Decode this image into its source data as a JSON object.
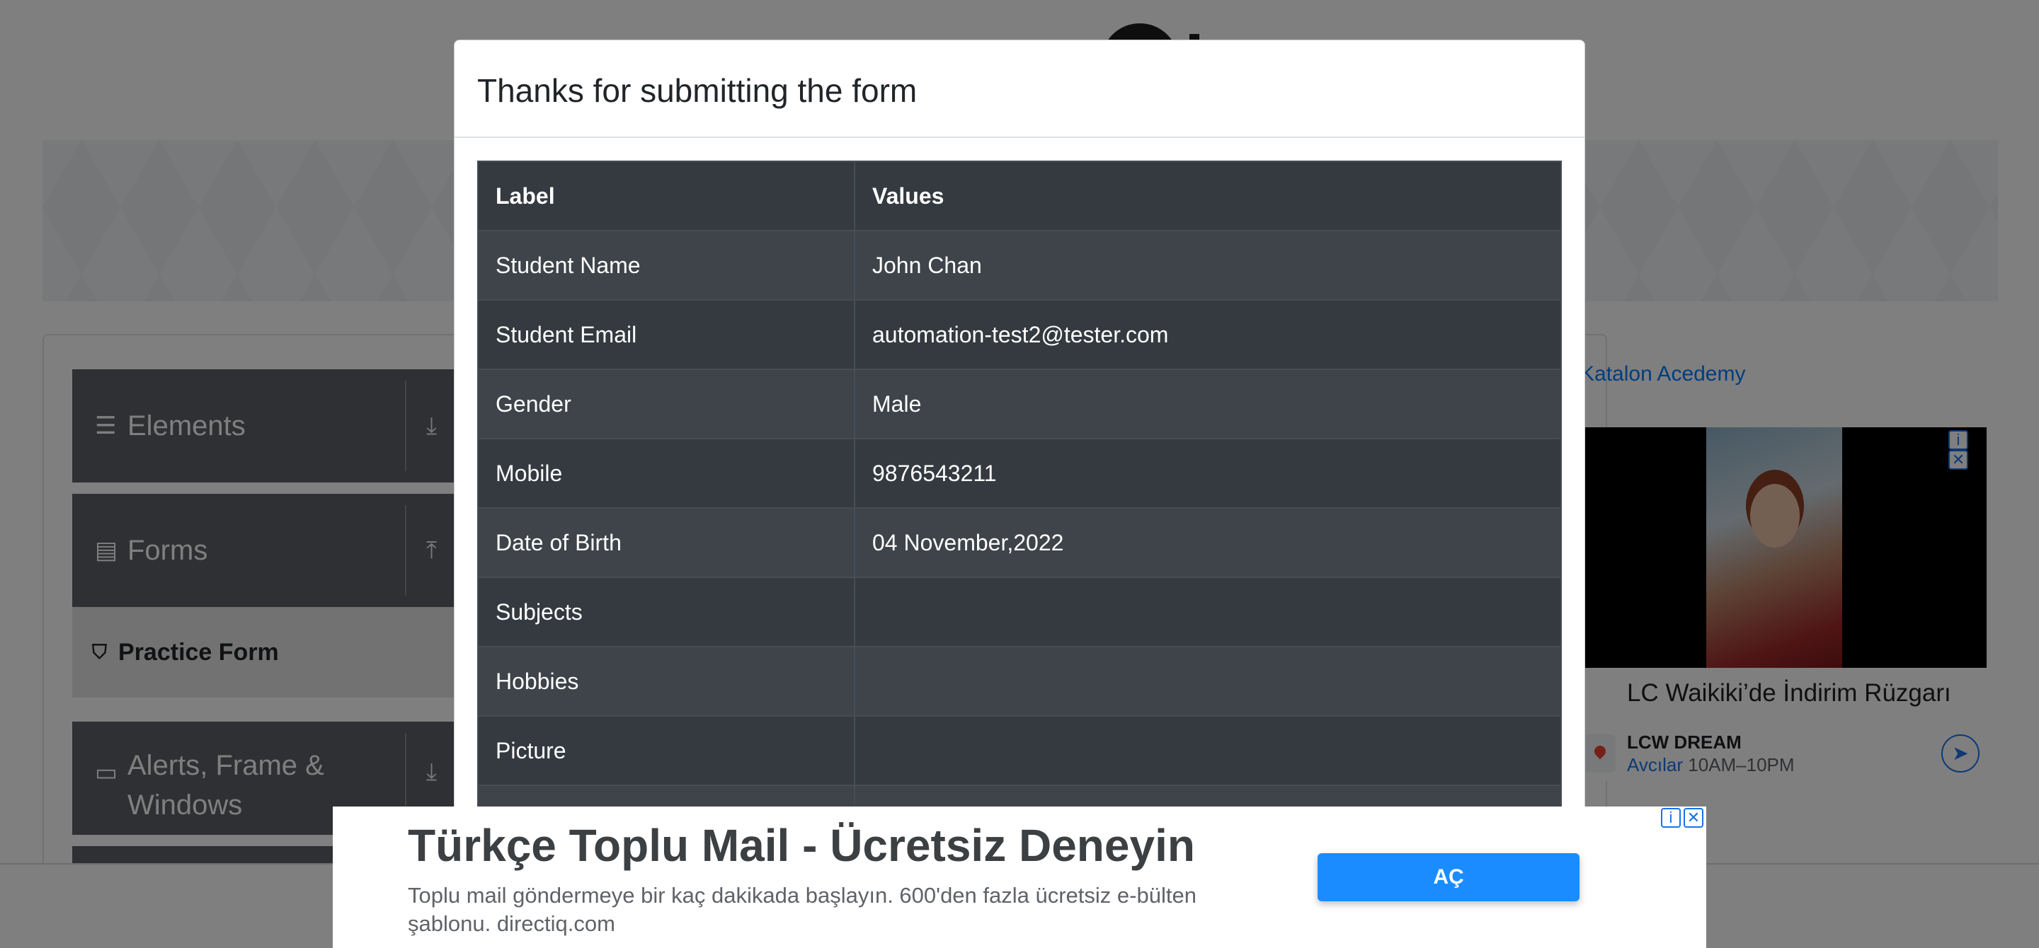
{
  "modal": {
    "title": "Thanks for submitting the form",
    "headers": {
      "label": "Label",
      "values": "Values"
    },
    "rows": [
      {
        "label": "Student Name",
        "value": "John Chan"
      },
      {
        "label": "Student Email",
        "value": "automation-test2@tester.com"
      },
      {
        "label": "Gender",
        "value": "Male"
      },
      {
        "label": "Mobile",
        "value": "9876543211"
      },
      {
        "label": "Date of Birth",
        "value": "04 November,2022"
      },
      {
        "label": "Subjects",
        "value": ""
      },
      {
        "label": "Hobbies",
        "value": ""
      },
      {
        "label": "Picture",
        "value": ""
      }
    ]
  },
  "sidebar": {
    "groups": [
      {
        "label": "Elements",
        "icon": "menu-icon",
        "arrow": "download-icon"
      },
      {
        "label": "Forms",
        "icon": "document-icon",
        "arrow": "upload-icon"
      },
      {
        "label": "Alerts, Frame &",
        "label2": "Windows",
        "icon": "window-icon",
        "arrow": "download-icon"
      }
    ],
    "active_item": {
      "label": "Practice Form",
      "icon": "html5-icon"
    }
  },
  "side_ad": {
    "link": "Katalon Acedemy",
    "title": "LC Waikiki’de İndirim Rüzgarı",
    "store_name": "LCW DREAM",
    "store_location": "Avcılar",
    "store_hours": "10AM–10PM"
  },
  "bottom_ad": {
    "headline": "Türkçe Toplu Mail - Ücretsiz Deneyin",
    "description": "Toplu mail göndermeye bir kaç dakikada başlayın. 600'den fazla ücretsiz e-bülten şablonu. directiq.com",
    "cta": "AÇ"
  },
  "colors": {
    "table_dark": "#343a40",
    "table_stripe": "#3e444a",
    "ad_button": "#1a8cff",
    "link": "#007bff"
  }
}
